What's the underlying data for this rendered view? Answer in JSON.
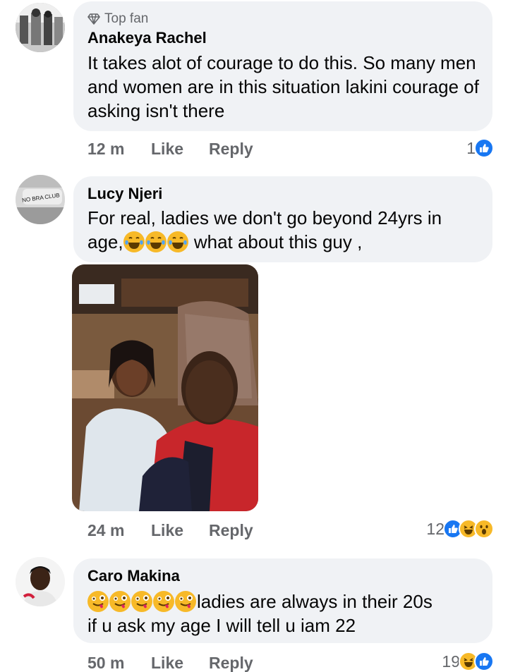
{
  "comments": [
    {
      "badge": "Top fan",
      "author": "Anakeya Rachel",
      "text": "It takes alot of courage to do this. So many men and women are in this situation lakini courage of asking isn't there",
      "time": "12 m",
      "like": "Like",
      "reply": "Reply",
      "reaction_count": "1",
      "reactions": [
        "like-icon"
      ]
    },
    {
      "author": "Lucy Njeri",
      "avatar_text": "NO BRA CLUB",
      "text_line1": "For real, ladies we don't go beyond 24yrs in",
      "text_line2_pre": "age,",
      "text_line2_post": " what about this guy  ,",
      "time": "24 m",
      "like": "Like",
      "reply": "Reply",
      "reaction_count": "12",
      "reactions": [
        "like-icon",
        "haha-icon",
        "wow-icon"
      ]
    },
    {
      "author": "Caro Makina",
      "text_line1_post": "ladies are always in their 20s",
      "text_line2": "if u ask my age I will tell u iam 22",
      "time": "50 m",
      "like": "Like",
      "reply": "Reply",
      "reaction_count": "19",
      "reactions": [
        "haha-icon",
        "like-icon"
      ]
    }
  ],
  "colors": {
    "bubble": "#f0f2f5",
    "meta_text": "#65676b",
    "like_blue": "#1877f2",
    "emoji_yellow": "#f7b928"
  }
}
